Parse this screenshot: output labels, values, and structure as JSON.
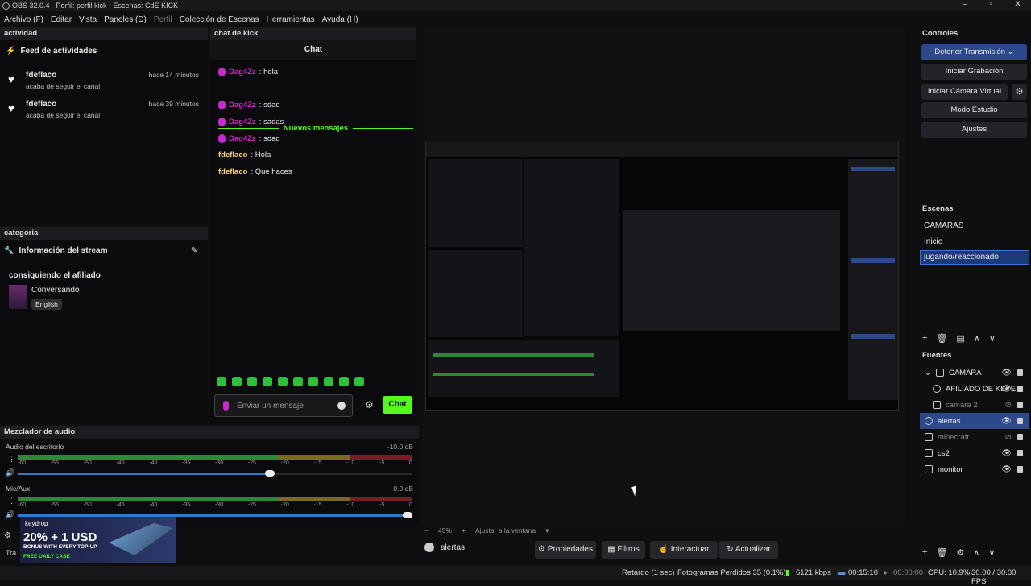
{
  "window": {
    "title": "OBS 32.0.4 - Perfil: perfil kick - Escenas: CdE KICK",
    "controls": [
      "–",
      "▫",
      "✕"
    ]
  },
  "menu": [
    {
      "label": "Archivo (F)",
      "disabled": false
    },
    {
      "label": "Editar",
      "disabled": false
    },
    {
      "label": "Vista",
      "disabled": false
    },
    {
      "label": "Paneles (D)",
      "disabled": false
    },
    {
      "label": "Perfil",
      "disabled": true
    },
    {
      "label": "Colección de Escenas",
      "disabled": false
    },
    {
      "label": "Herramientas",
      "disabled": false
    },
    {
      "label": "Ayuda (H)",
      "disabled": false
    }
  ],
  "activity": {
    "dock_title": "actividad",
    "feed_title": "Feed de actividades",
    "items": [
      {
        "user": "fdeflaco",
        "text": "acaba de seguir el canal",
        "time": "hace 14 minutos"
      },
      {
        "user": "fdeflaco",
        "text": "acaba de seguir el canal",
        "time": "hace 39 minutos"
      }
    ]
  },
  "chat": {
    "dock_title": "chat de kick",
    "header": "Chat",
    "new_messages": "Nuevos mensajes",
    "messages": [
      {
        "user": "Dag4Zz",
        "text": ": hola"
      },
      {
        "user": "Dag4Zz",
        "text": ": sdad"
      },
      {
        "user": "Dag4Zz",
        "text": ": sadas"
      },
      {
        "user": "Dag4Zz",
        "text": ": sdad"
      },
      {
        "user": "fdeflaco",
        "text": ": Hola"
      },
      {
        "user": "fdeflaco",
        "text": ": Que haces"
      }
    ],
    "input_placeholder": "Enviar un mensaje",
    "send_label": "Chat"
  },
  "category": {
    "dock_title": "categoria",
    "title": "Información del stream",
    "stream_title": "consiguiendo el afiliado",
    "category_name": "Conversando",
    "tag": "English"
  },
  "mixer": {
    "dock_title": "Mezclador de audio",
    "channels": [
      {
        "name": "Audio del escritorio",
        "db": "-10.0 dB",
        "volume": 0.65
      },
      {
        "name": "Mic/Aux",
        "db": "0.0 dB",
        "volume": 1.0
      }
    ],
    "ticks": [
      "-60",
      "-55",
      "-50",
      "-45",
      "-40",
      "-35",
      "-30",
      "-25",
      "-20",
      "-15",
      "-10",
      "-5",
      "0"
    ]
  },
  "promo": {
    "brand": "keydrop",
    "headline": "20% + 1 USD",
    "line2": "BONUS WITH EVERY TOP-UP",
    "line3": "FREE DAILY CASE"
  },
  "bottom_left_partial": "Tra",
  "preview": {
    "zoom": "45%",
    "fit_label": "Ajustar a la ventana",
    "selected_source": "alertas",
    "tools": [
      "Propiedades",
      "Filtros",
      "Interactuar",
      "Actualizar"
    ]
  },
  "controls": {
    "dock_title": "Controles",
    "buttons": [
      "Detener Transmisión",
      "Iniciar Grabación",
      "Iniciar Cámara Virtual",
      "Modo Estudio",
      "Ajustes"
    ]
  },
  "scenes": {
    "dock_title": "Escenas",
    "items": [
      "CAMARAS",
      "Inicio",
      "jugando/reaccionado"
    ],
    "selected": 2
  },
  "sources": {
    "dock_title": "Fuentes",
    "items": [
      {
        "name": "CAMARA",
        "indent": 0,
        "dim": false,
        "selected": false
      },
      {
        "name": "AFILIADO DE KEYE",
        "indent": 1,
        "dim": false,
        "selected": false
      },
      {
        "name": "camara 2",
        "indent": 1,
        "dim": true,
        "selected": false
      },
      {
        "name": "alertas",
        "indent": 0,
        "dim": false,
        "selected": true
      },
      {
        "name": "minecraft",
        "indent": 0,
        "dim": true,
        "selected": false
      },
      {
        "name": "cs2",
        "indent": 0,
        "dim": false,
        "selected": false
      },
      {
        "name": "monitor",
        "indent": 0,
        "dim": false,
        "selected": false
      }
    ]
  },
  "status": {
    "delay": "Retardo (1 sec)",
    "dropped": "Fotogramas Perdidos 35 (0.1%)",
    "bitrate": "6121 kbps",
    "stream_time": "00:15:10",
    "rec_time": "00:00:00",
    "cpu": "CPU: 10.9%",
    "fps": "30.00 / 30.00 FPS"
  },
  "colors": {
    "kick_green": "#53fc18",
    "accent_blue": "#2c4a8a",
    "badge_purple": "#c62ad0"
  }
}
